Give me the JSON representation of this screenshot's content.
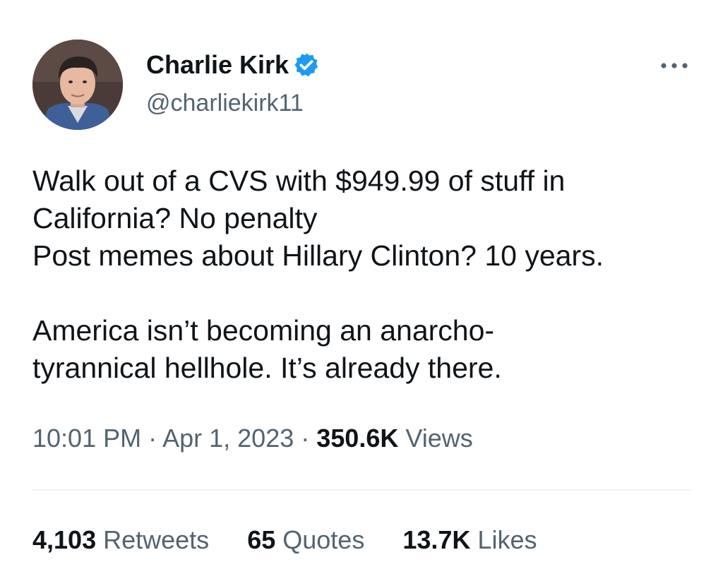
{
  "author": {
    "display_name": "Charlie Kirk",
    "handle": "@charliekirk11",
    "verified_color": "#1d9bf0"
  },
  "tweet": {
    "lines": [
      "Walk out of a CVS with $949.99 of stuff in",
      "California? No penalty",
      "Post memes about Hillary Clinton? 10 years.",
      "",
      "America isn’t becoming an anarcho-",
      "tyrannical hellhole. It’s already there."
    ]
  },
  "meta": {
    "time": "10:01 PM",
    "separator": " · ",
    "date": "Apr 1, 2023",
    "views_count": "350.6K",
    "views_label": "Views"
  },
  "stats": {
    "retweets_count": "4,103",
    "retweets_label": "Retweets",
    "quotes_count": "65",
    "quotes_label": "Quotes",
    "likes_count": "13.7K",
    "likes_label": "Likes"
  },
  "icons": {
    "verified": "verified-badge-icon",
    "more": "more-options-icon"
  }
}
